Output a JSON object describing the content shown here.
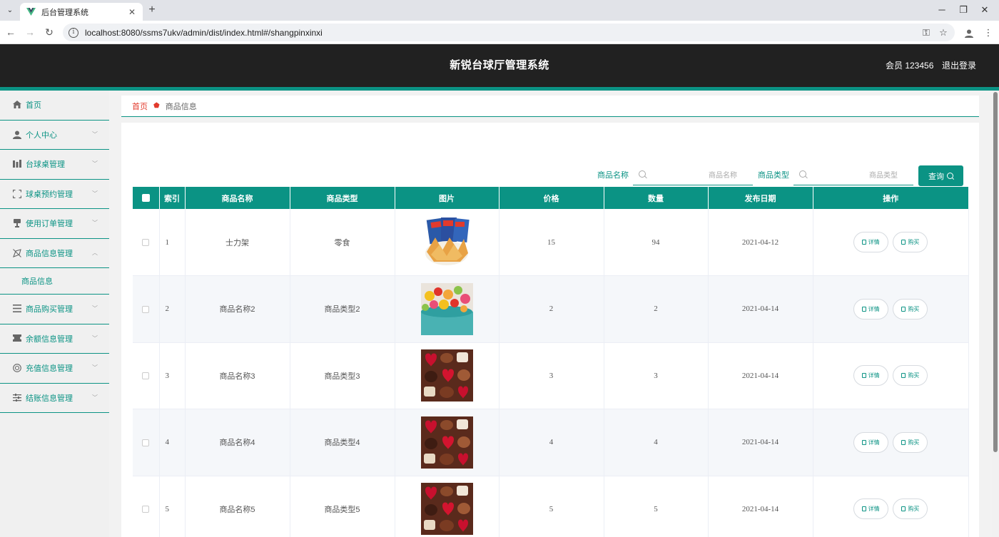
{
  "browser": {
    "tab_title": "后台管理系统",
    "url": "localhost:8080/ssms7ukv/admin/dist/index.html#/shangpinxinxi"
  },
  "header": {
    "title": "新锐台球厅管理系统",
    "user": "会员 123456",
    "logout": "退出登录"
  },
  "sidebar": {
    "items": [
      {
        "label": "首页",
        "icon": "home-icon"
      },
      {
        "label": "个人中心",
        "icon": "user-icon"
      },
      {
        "label": "台球桌管理",
        "icon": "table-icon"
      },
      {
        "label": "球桌预约管理",
        "icon": "frame-icon"
      },
      {
        "label": "使用订单管理",
        "icon": "order-icon"
      },
      {
        "label": "商品信息管理",
        "icon": "goods-icon"
      },
      {
        "label": "商品购买管理",
        "icon": "list-icon"
      },
      {
        "label": "余额信息管理",
        "icon": "ticket-icon"
      },
      {
        "label": "充值信息管理",
        "icon": "recharge-icon"
      },
      {
        "label": "结账信息管理",
        "icon": "settings-icon"
      }
    ],
    "subitem": "商品信息"
  },
  "breadcrumb": {
    "home": "首页",
    "current": "商品信息"
  },
  "search": {
    "name_label": "商品名称",
    "name_placeholder": "商品名称",
    "type_label": "商品类型",
    "type_placeholder": "商品类型",
    "button": "查询"
  },
  "table": {
    "columns": [
      "索引",
      "商品名称",
      "商品类型",
      "图片",
      "价格",
      "数量",
      "发布日期",
      "操作"
    ],
    "rows": [
      {
        "index": "1",
        "name": "士力架",
        "type": "零食",
        "price": "15",
        "qty": "94",
        "date": "2021-04-12",
        "image": "snack-bag"
      },
      {
        "index": "2",
        "name": "商品名称2",
        "type": "商品类型2",
        "price": "2",
        "qty": "2",
        "date": "2021-04-14",
        "image": "candy-cup"
      },
      {
        "index": "3",
        "name": "商品名称3",
        "type": "商品类型3",
        "price": "3",
        "qty": "3",
        "date": "2021-04-14",
        "image": "chocolates"
      },
      {
        "index": "4",
        "name": "商品名称4",
        "type": "商品类型4",
        "price": "4",
        "qty": "4",
        "date": "2021-04-14",
        "image": "chocolates"
      },
      {
        "index": "5",
        "name": "商品名称5",
        "type": "商品类型5",
        "price": "5",
        "qty": "5",
        "date": "2021-04-14",
        "image": "chocolates"
      }
    ],
    "detail_btn": "详情",
    "buy_btn": "购买"
  },
  "colors": {
    "accent": "#0b9384",
    "header_bg": "#212121",
    "breadcrumb_home": "#e23a2c"
  }
}
